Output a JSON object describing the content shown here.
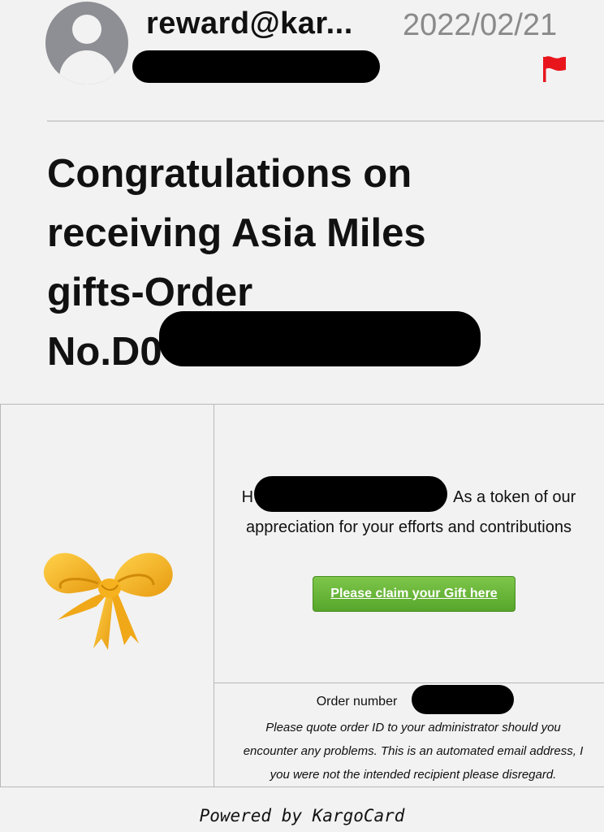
{
  "header": {
    "sender": "reward@kar...",
    "date": "2022/02/21",
    "flag_color": "#e8161c"
  },
  "subject": {
    "line1": "Congratulations on",
    "line2": "receiving Asia Miles",
    "line3": "gifts-Order",
    "line4": "No.D0"
  },
  "body": {
    "greeting_prefix": "H",
    "greeting_suffix": "As a token of our",
    "greeting_line2": "appreciation for your efforts and contributions",
    "claim_button": "Please claim your Gift here",
    "order_label": "Order number",
    "note_line1": "Please quote order ID to your administrator should you",
    "note_line2": "encounter any problems. This is an automated email address, I",
    "note_line3": "you were not the intended recipient please disregard."
  },
  "footer": {
    "powered_by": "Powered by KargoCard"
  },
  "colors": {
    "button_green": "#66b436",
    "bow_gold": "#f6b21e",
    "background": "#f2f2f2"
  }
}
